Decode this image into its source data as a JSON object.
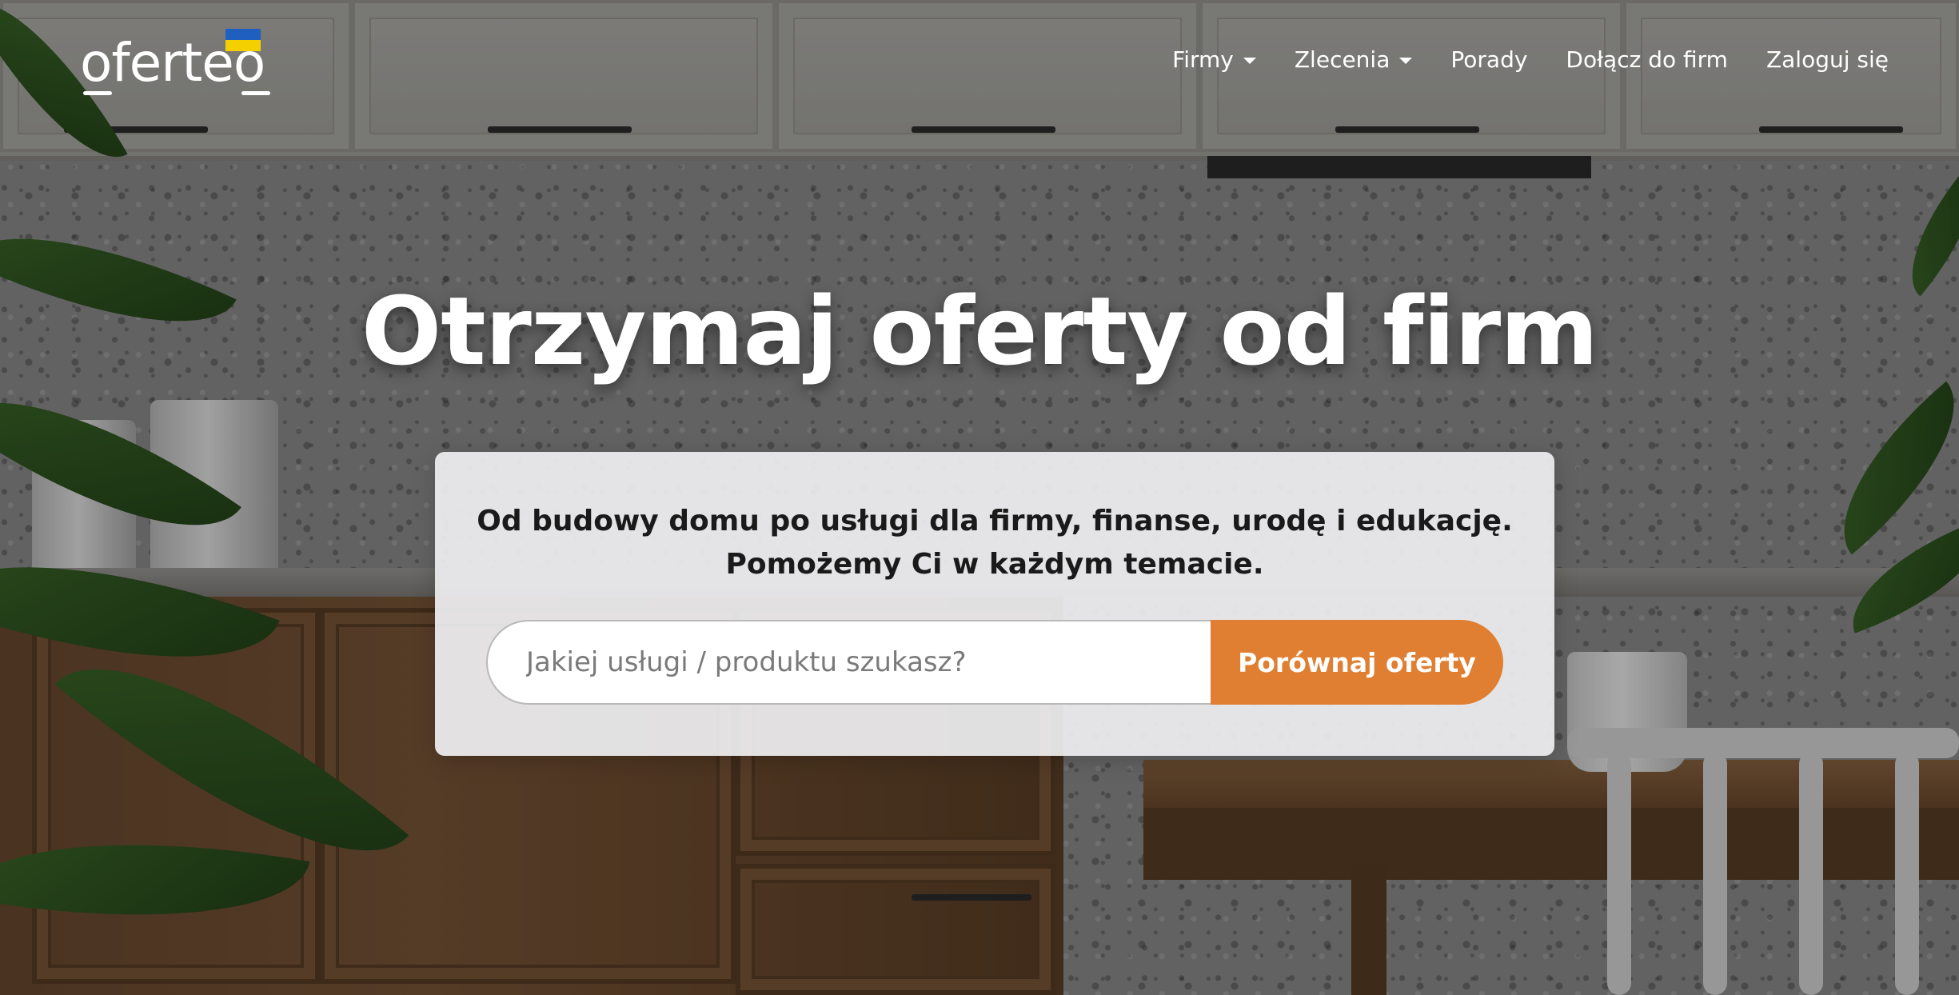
{
  "header": {
    "logo_text": "oferteo",
    "flag_colors": {
      "top": "#1f5fbf",
      "bottom": "#f5d000"
    },
    "nav": [
      {
        "label": "Firmy",
        "has_dropdown": true
      },
      {
        "label": "Zlecenia",
        "has_dropdown": true
      },
      {
        "label": "Porady",
        "has_dropdown": false
      },
      {
        "label": "Dołącz do firm",
        "has_dropdown": false
      },
      {
        "label": "Zaloguj się",
        "has_dropdown": false
      }
    ]
  },
  "hero": {
    "title": "Otrzymaj oferty od firm",
    "subtitle_line1": "Od budowy domu po usługi dla firmy, finanse, urodę i edukację.",
    "subtitle_line2": "Pomożemy Ci w każdym temacie.",
    "search": {
      "placeholder": "Jakiej usługi / produktu szukasz?",
      "value": ""
    },
    "button_label": "Porównaj oferty"
  },
  "colors": {
    "accent": "#e07f32",
    "card_background": "#eeeef0",
    "text_dark": "#1a1a1a"
  },
  "icons": {
    "dropdown": "caret-down-icon"
  }
}
